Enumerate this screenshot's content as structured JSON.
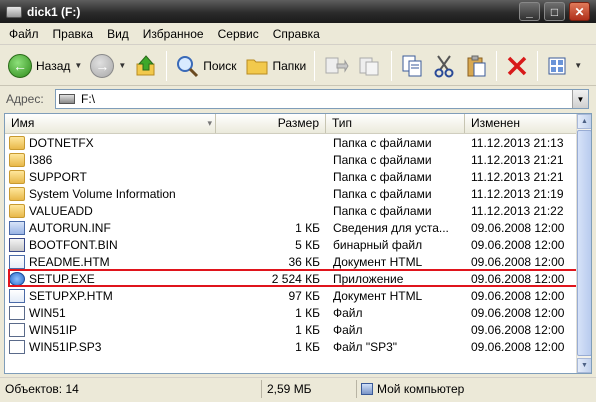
{
  "window": {
    "title": "dick1 (F:)"
  },
  "menu": [
    "Файл",
    "Правка",
    "Вид",
    "Избранное",
    "Сервис",
    "Справка"
  ],
  "toolbar": {
    "back_label": "Назад",
    "search_label": "Поиск",
    "folders_label": "Папки"
  },
  "address": {
    "label": "Адрес:",
    "value": "F:\\"
  },
  "columns": {
    "name": "Имя",
    "size": "Размер",
    "type": "Тип",
    "modified": "Изменен"
  },
  "files": [
    {
      "name": "DOTNETFX",
      "size": "",
      "type": "Папка с файлами",
      "modified": "11.12.2013 21:13",
      "icon": "folder-icon"
    },
    {
      "name": "I386",
      "size": "",
      "type": "Папка с файлами",
      "modified": "11.12.2013 21:21",
      "icon": "folder-icon"
    },
    {
      "name": "SUPPORT",
      "size": "",
      "type": "Папка с файлами",
      "modified": "11.12.2013 21:21",
      "icon": "folder-icon"
    },
    {
      "name": "System Volume Information",
      "size": "",
      "type": "Папка с файлами",
      "modified": "11.12.2013 21:19",
      "icon": "folder-icon"
    },
    {
      "name": "VALUEADD",
      "size": "",
      "type": "Папка с файлами",
      "modified": "11.12.2013 21:22",
      "icon": "folder-icon"
    },
    {
      "name": "AUTORUN.INF",
      "size": "1 КБ",
      "type": "Сведения для уста...",
      "modified": "09.06.2008 12:00",
      "icon": "inf-file-icon"
    },
    {
      "name": "BOOTFONT.BIN",
      "size": "5 КБ",
      "type": "бинарный файл",
      "modified": "09.06.2008 12:00",
      "icon": "bin-file-icon"
    },
    {
      "name": "README.HTM",
      "size": "36 КБ",
      "type": "Документ HTML",
      "modified": "09.06.2008 12:00",
      "icon": "htm-file-icon"
    },
    {
      "name": "SETUP.EXE",
      "size": "2 524 КБ",
      "type": "Приложение",
      "modified": "09.06.2008 12:00",
      "icon": "exe-file-icon"
    },
    {
      "name": "SETUPXP.HTM",
      "size": "97 КБ",
      "type": "Документ HTML",
      "modified": "09.06.2008 12:00",
      "icon": "htm-file-icon"
    },
    {
      "name": "WIN51",
      "size": "1 КБ",
      "type": "Файл",
      "modified": "09.06.2008 12:00",
      "icon": "generic-file-icon"
    },
    {
      "name": "WIN51IP",
      "size": "1 КБ",
      "type": "Файл",
      "modified": "09.06.2008 12:00",
      "icon": "generic-file-icon"
    },
    {
      "name": "WIN51IP.SP3",
      "size": "1 КБ",
      "type": "Файл \"SP3\"",
      "modified": "09.06.2008 12:00",
      "icon": "generic-file-icon"
    }
  ],
  "status": {
    "objects": "Объектов: 14",
    "total_size": "2,59 МБ",
    "location": "Мой компьютер"
  },
  "colors": {
    "highlight_border": "#e0141c",
    "window_bg": "#ece9d8"
  }
}
